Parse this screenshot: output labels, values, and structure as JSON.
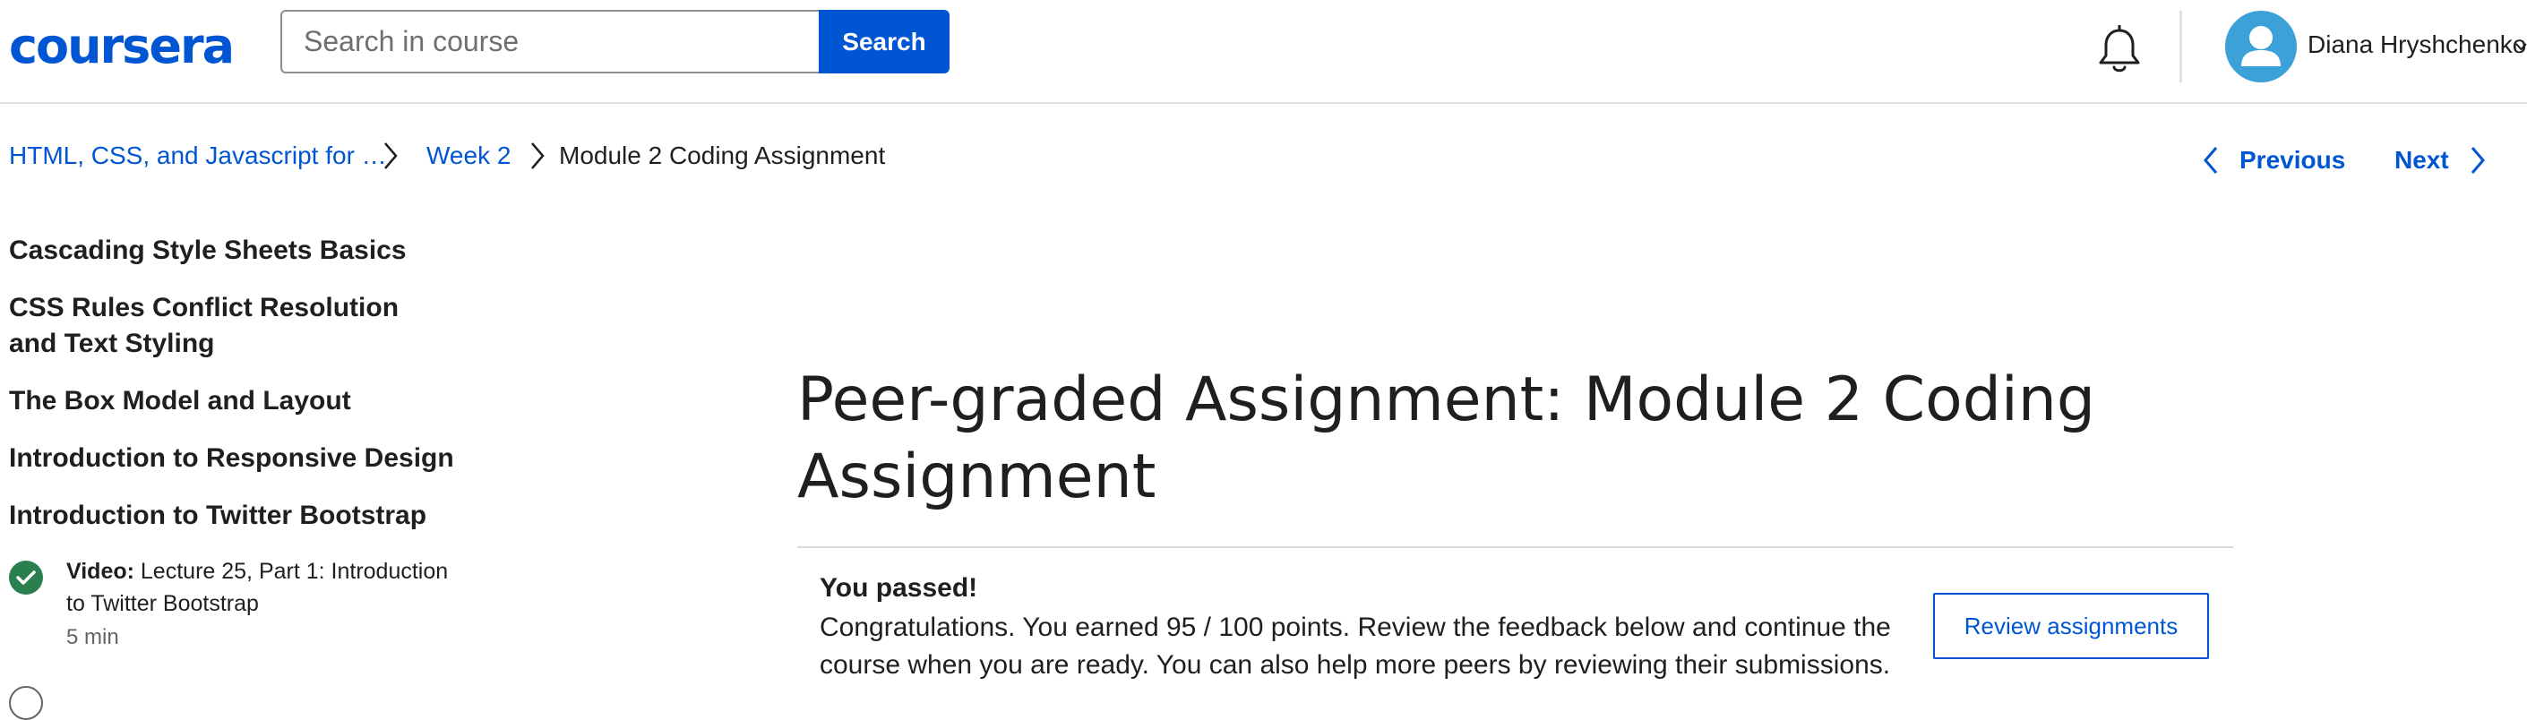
{
  "header": {
    "logo_text": "coursera",
    "search": {
      "placeholder": "Search in course",
      "button_label": "Search"
    },
    "user": {
      "name": "Diana Hryshchenko"
    }
  },
  "breadcrumb": {
    "course": "HTML, CSS, and Javascript for …",
    "week": "Week 2",
    "current": "Module 2 Coding Assignment"
  },
  "pagination": {
    "previous": "Previous",
    "next": "Next"
  },
  "sidebar": {
    "sections": [
      "Cascading Style Sheets Basics",
      "CSS Rules Conflict Resolution and Text Styling",
      "The Box Model and Layout",
      "Introduction to Responsive Design",
      "Introduction to Twitter Bootstrap"
    ],
    "items": [
      {
        "type_label": "Video:",
        "title": "Lecture 25, Part 1: Introduction to Twitter Bootstrap",
        "duration": "5 min",
        "status": "completed"
      }
    ]
  },
  "main": {
    "title": "Peer-graded Assignment: Module 2 Coding Assignment",
    "result": {
      "heading": "You passed!",
      "message": "Congratulations. You earned 95 / 100 points. Review the feedback below and continue the course when you are ready. You can also help more peers by reviewing their submissions.",
      "button_label": "Review assignments"
    }
  },
  "colors": {
    "brand": "#0056d2",
    "success": "#2a7f4f",
    "avatar": "#3ba1d8"
  }
}
